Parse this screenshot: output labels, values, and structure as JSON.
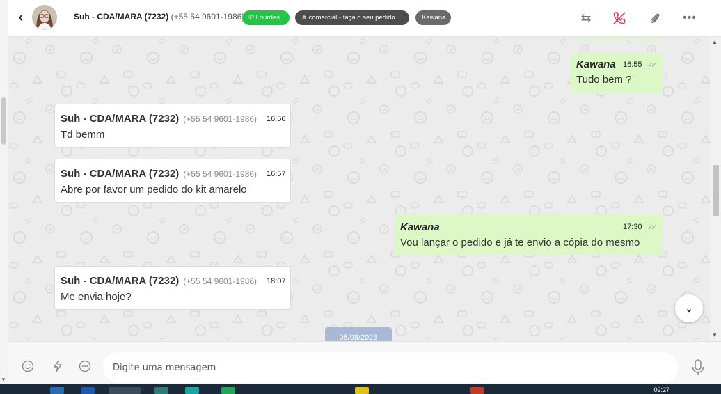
{
  "header": {
    "back_label": "‹",
    "contact_name": "Suh - CDA/MARA (7232)",
    "contact_phone": "(+55 54 9601-1986)",
    "tags": [
      {
        "label": "Lourdes",
        "color": "#25c347",
        "icon": "whatsapp-icon"
      },
      {
        "label": "comercial - faça o seu pedido",
        "color": "#4d4d4d",
        "icon": "sitemap-icon"
      },
      {
        "label": "Kawana",
        "color": "#6a6a6a"
      }
    ],
    "actions": [
      "transfer-icon",
      "end-chat-icon",
      "paperclip-icon",
      "more-icon"
    ]
  },
  "messages": [
    {
      "direction": "out",
      "sender": "Kawana",
      "time": "16:55",
      "text": "Tudo bem ?"
    },
    {
      "direction": "in",
      "sender": "Suh - CDA/MARA (7232)",
      "phone": "(+55 54 9601-1986)",
      "time": "16:56",
      "text": "Td bemm"
    },
    {
      "direction": "in",
      "sender": "Suh - CDA/MARA (7232)",
      "phone": "(+55 54 9601-1986)",
      "time": "16:57",
      "text": "Abre por favor um pedido do kit amarelo"
    },
    {
      "direction": "out",
      "sender": "Kawana",
      "time": "17:30",
      "text": "Vou lançar o pedido e já te envio a cópia do mesmo"
    },
    {
      "direction": "in",
      "sender": "Suh - CDA/MARA (7232)",
      "phone": "(+55 54 9601-1986)",
      "time": "18:07",
      "text": "Me envia hoje?"
    }
  ],
  "date_divider": "08/08/2023",
  "composer": {
    "placeholder": "Digite uma mensagem",
    "icons": [
      "emoji-icon",
      "lightning-icon",
      "chat-dots-icon",
      "microphone-icon"
    ]
  },
  "taskbar": {
    "clock": "09:27"
  },
  "colors": {
    "outgoing_bubble": "#dcf8c6",
    "incoming_bubble": "#ffffff",
    "chat_bg": "#ececec",
    "accent_green": "#25c347",
    "end_call_red": "#d93b5b"
  }
}
